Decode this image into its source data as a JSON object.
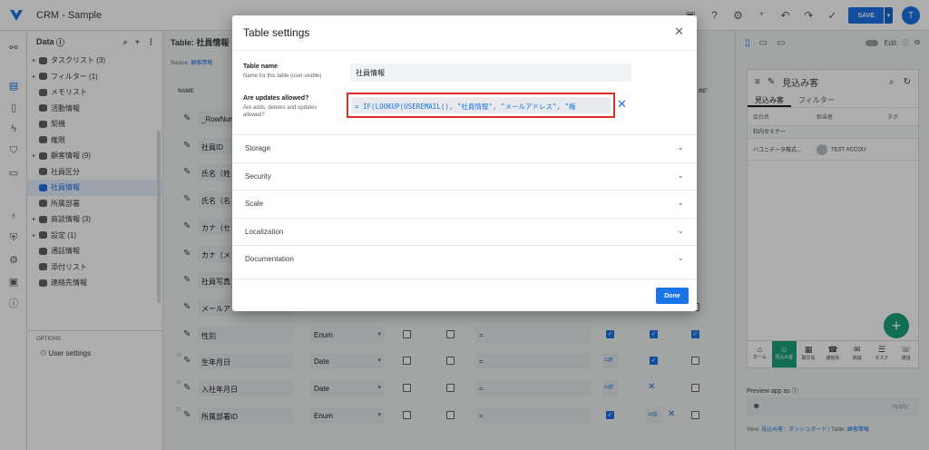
{
  "app": {
    "title": "CRM - Sample",
    "save_label": "SAVE",
    "avatar_initial": "T"
  },
  "data_panel": {
    "title": "Data",
    "items": [
      {
        "label": "タスクリスト (3)",
        "arrow": "▸"
      },
      {
        "label": "フィルター (1)",
        "arrow": "▸"
      },
      {
        "label": "メモリスト",
        "arrow": ""
      },
      {
        "label": "活動情報",
        "arrow": ""
      },
      {
        "label": "契機",
        "arrow": ""
      },
      {
        "label": "権限",
        "arrow": ""
      },
      {
        "label": "顧客情報 (9)",
        "arrow": "▸"
      },
      {
        "label": "社員区分",
        "arrow": ""
      },
      {
        "label": "社員情報",
        "arrow": ""
      },
      {
        "label": "所属部署",
        "arrow": ""
      },
      {
        "label": "商談情報 (3)",
        "arrow": "▸"
      },
      {
        "label": "設定 (1)",
        "arrow": "▸"
      },
      {
        "label": "通話情報",
        "arrow": ""
      },
      {
        "label": "添付リスト",
        "arrow": ""
      },
      {
        "label": "連絡先情報",
        "arrow": ""
      }
    ],
    "options_label": "OPTIONS",
    "user_settings": "User settings"
  },
  "table_area": {
    "title": "Table: 社員情報",
    "source_prefix": "Source:",
    "source_name": "顧客情報",
    "col_name": "NAME",
    "col_right": "RE'",
    "rows": [
      {
        "num": "",
        "name": "_RowNumber",
        "type": ""
      },
      {
        "num": "",
        "name": "社員ID",
        "type": ""
      },
      {
        "num": "",
        "name": "氏名（姓",
        "type": ""
      },
      {
        "num": "",
        "name": "氏名（名",
        "type": ""
      },
      {
        "num": "",
        "name": "カナ（セ",
        "type": ""
      },
      {
        "num": "",
        "name": "カナ（メ",
        "type": ""
      },
      {
        "num": "",
        "name": "社員写真",
        "type": ""
      },
      {
        "num": "",
        "name": "メールア",
        "type": ""
      },
      {
        "num": "",
        "name": "性別",
        "type": "Enum"
      },
      {
        "num": "10",
        "name": "生年月日",
        "type": "Date"
      },
      {
        "num": "11",
        "name": "入社年月日",
        "type": "Date"
      },
      {
        "num": "12",
        "name": "所属部署ID",
        "type": "Enum"
      }
    ],
    "formula_prefix": "=",
    "eq_short": "=IF",
    "eq_short2": "=IS"
  },
  "preview": {
    "edit_label": "Edit",
    "view_title": "見込み客",
    "tab_on": "見込み客",
    "tab_off": "フィルター",
    "col1": "会社名",
    "col2": "担当者",
    "col3": "タグ",
    "group": "社内セミナー",
    "row_company": "ハコニデータ株式...",
    "row_person": "TEST ACCOU",
    "nav": [
      {
        "label": "ホーム",
        "glyph": "⌂"
      },
      {
        "label": "見込み客",
        "glyph": "☺"
      },
      {
        "label": "取引先",
        "glyph": "▦"
      },
      {
        "label": "通信先",
        "glyph": "☎"
      },
      {
        "label": "商談",
        "glyph": "✉"
      },
      {
        "label": "タスク",
        "glyph": "☰"
      },
      {
        "label": "通話",
        "glyph": "☏"
      }
    ],
    "preview_as": "Preview app as",
    "apply": "Apply",
    "view_prefix": "View:",
    "view_link": "見込み客：ダッシュボード",
    "table_prefix": "| Table:",
    "table_link": "顧客情報"
  },
  "modal": {
    "title": "Table settings",
    "table_name_label": "Table name",
    "table_name_help": "Name for this table (user-visible)",
    "table_name_value": "社員情報",
    "updates_label": "Are updates allowed?",
    "updates_help": "Are adds, deletes and updates allowed?",
    "expression": "= IF(LOOKUP(USEREMAIL(), \"社員情報\", \"メールアドレス\", \"権",
    "sections": [
      "Storage",
      "Security",
      "Scale",
      "Localization",
      "Documentation"
    ],
    "done_label": "Done"
  },
  "colors": {
    "accent": "#1a73e8",
    "highlight": "#d93025",
    "fab": "#1aa37a"
  }
}
